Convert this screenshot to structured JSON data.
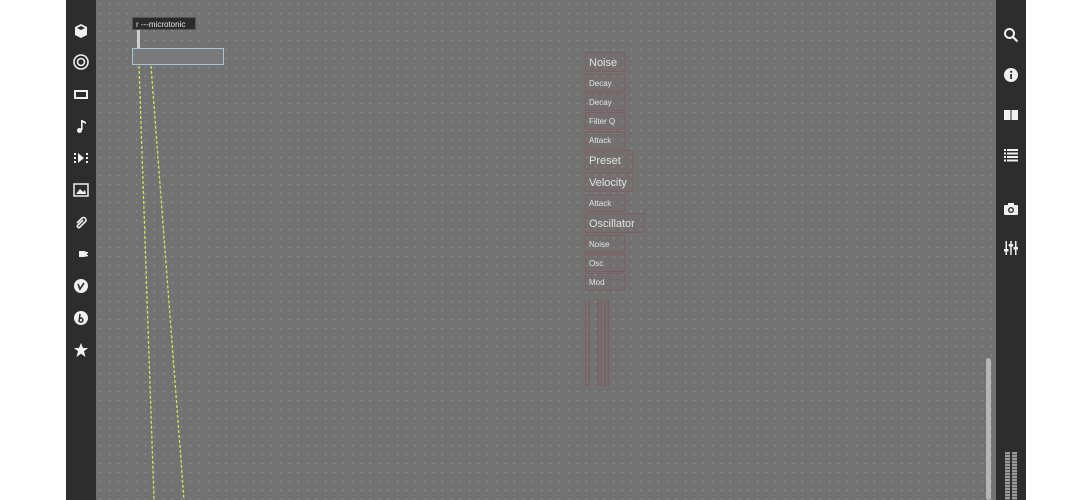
{
  "left_toolbar": {
    "icons": [
      "package-icon",
      "target-icon",
      "film-icon",
      "music-note-icon",
      "playlist-icon",
      "image-icon",
      "paperclip-icon",
      "plug-icon",
      "vimeo-icon",
      "bold-b-icon",
      "star-icon"
    ]
  },
  "right_toolbar": {
    "icons": [
      "search-icon",
      "info-icon",
      "book-icon",
      "list-icon",
      "camera-icon",
      "mixer-icon"
    ]
  },
  "patcher": {
    "receive_object": "r ---microtonic",
    "parameter_labels": [
      "Noise",
      "Decay",
      "Decay",
      "Filter Q",
      "Attack",
      "Preset",
      "Velocity",
      "Attack",
      "Oscillator",
      "Noise",
      "Osc",
      "Mod"
    ]
  },
  "colors": {
    "canvas": "#727272",
    "toolbar": "#2d2d2d",
    "patch_cord": "#cfe85a",
    "object_border": "#a8c4d8"
  }
}
